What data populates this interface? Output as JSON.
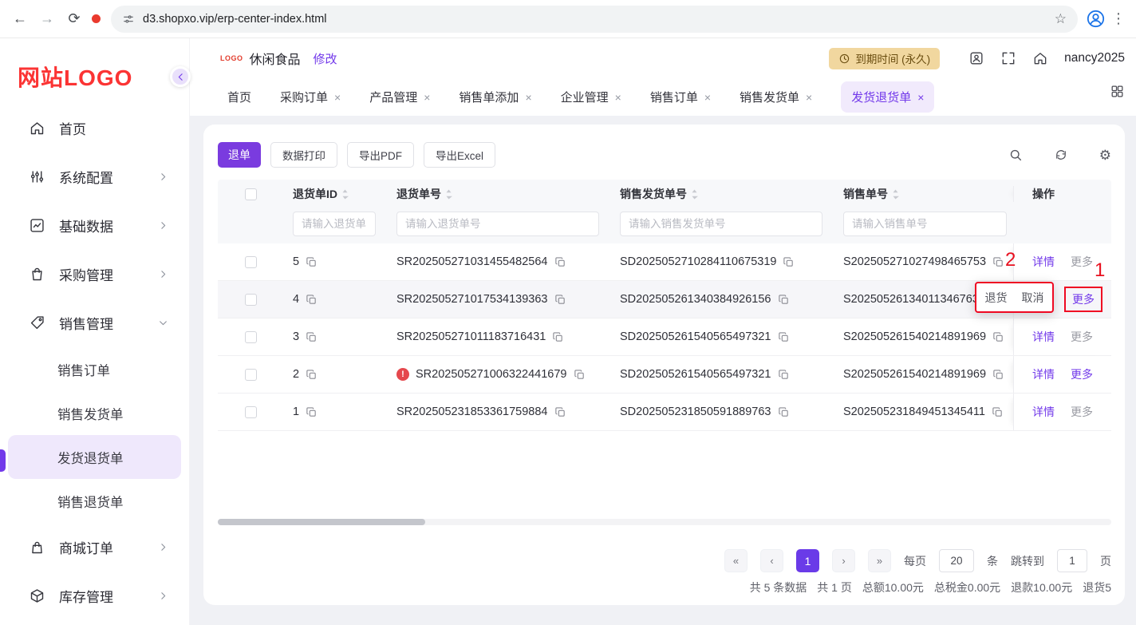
{
  "browser": {
    "url": "d3.shopxo.vip/erp-center-index.html"
  },
  "icons": {
    "back": "←",
    "forward": "→",
    "refresh": "⟳",
    "star": "☆",
    "menu": "⋮",
    "close": "×",
    "gear": "⚙",
    "first": "«",
    "prev": "‹",
    "next": "›",
    "last": "»",
    "warning": "!"
  },
  "sidebar": {
    "logo": "网站LOGO",
    "menu": [
      {
        "label": "首页"
      },
      {
        "label": "系统配置"
      },
      {
        "label": "基础数据"
      },
      {
        "label": "采购管理"
      },
      {
        "label": "销售管理"
      },
      {
        "label": "商城订单"
      },
      {
        "label": "库存管理"
      }
    ],
    "submenu": [
      {
        "label": "销售订单"
      },
      {
        "label": "销售发货单"
      },
      {
        "label": "发货退货单"
      },
      {
        "label": "销售退货单"
      }
    ]
  },
  "header": {
    "logo_badge": "LOGO",
    "company": "休闲食品",
    "modify": "修改",
    "expire": "到期时间 (永久)",
    "username": "nancy2025"
  },
  "tabs": [
    {
      "label": "首页"
    },
    {
      "label": "采购订单"
    },
    {
      "label": "产品管理"
    },
    {
      "label": "销售单添加"
    },
    {
      "label": "企业管理"
    },
    {
      "label": "销售订单"
    },
    {
      "label": "销售发货单"
    },
    {
      "label": "发货退货单"
    }
  ],
  "toolbar": {
    "return_btn": "退单",
    "print_btn": "数据打印",
    "export_pdf_btn": "导出PDF",
    "export_excel_btn": "导出Excel"
  },
  "table": {
    "columns": {
      "id": "退货单ID",
      "return_no": "退货单号",
      "ship_no": "销售发货单号",
      "sale_no": "销售单号",
      "ops": "操作"
    },
    "filters": {
      "id": "请输入退货单ID",
      "return_no": "请输入退货单号",
      "ship_no": "请输入销售发货单号",
      "sale_no": "请输入销售单号"
    },
    "detail_label": "详情",
    "more_label": "更多",
    "rows": [
      {
        "id": "5",
        "return_no": "SR202505271031455482564",
        "ship_no": "SD2025052710284110675319",
        "sale_no": "S202505271027498465753"
      },
      {
        "id": "4",
        "return_no": "SR202505271017534139363",
        "ship_no": "SD202505261340384926156",
        "sale_no": "S20250526134011346763"
      },
      {
        "id": "3",
        "return_no": "SR202505271011183716431",
        "ship_no": "SD202505261540565497321",
        "sale_no": "S202505261540214891969"
      },
      {
        "id": "2",
        "return_no": "SR202505271006322441679",
        "ship_no": "SD202505261540565497321",
        "sale_no": "S202505261540214891969"
      },
      {
        "id": "1",
        "return_no": "SR202505231853361759884",
        "ship_no": "SD202505231850591889763",
        "sale_no": "S202505231849451345411"
      }
    ]
  },
  "popup": {
    "return": "退货",
    "cancel": "取消"
  },
  "annotations": {
    "mark1": "1",
    "mark2": "2"
  },
  "pagination": {
    "page": "1",
    "per_page_label": "每页",
    "per_page_value": "20",
    "per_page_unit": "条",
    "jump_label": "跳转到",
    "jump_value": "1",
    "jump_unit": "页"
  },
  "summary": {
    "total_items": "共 5 条数据",
    "total_pages": "共 1 页",
    "total_amount": "总额10.00元",
    "total_tax": "总税金0.00元",
    "refund": "退款10.00元",
    "returns": "退货5"
  }
}
